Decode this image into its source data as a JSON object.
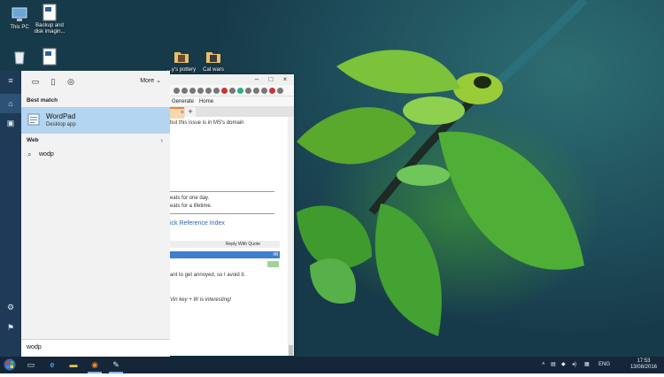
{
  "desktop": {
    "icons": [
      {
        "label": "This PC",
        "icon": "computer-icon"
      },
      {
        "label": "Backup and disk imagin...",
        "icon": "document-icon"
      },
      {
        "label": "",
        "icon": "recycle-bin-icon"
      },
      {
        "label": "",
        "icon": "document-icon"
      },
      {
        "label": "...y's pottery",
        "icon": "folder-icon"
      },
      {
        "label": "Cat wars",
        "icon": "folder-icon"
      }
    ]
  },
  "browser": {
    "bookmarks": {
      "item1": "Generate",
      "item2": "Home"
    },
    "tab_close": "×",
    "new_tab": "+",
    "lines": {
      "l1": "but this issue is in MS's domain",
      "l2": "eats for one day.",
      "l3": "eats for a lifetime.",
      "l4": "ick Reference Index",
      "reply": "Reply With Quote",
      "post_no": "#8",
      "l5": "ant to get annoyed, so I avoid it.",
      "l6": "Vin key + W is interesting!"
    }
  },
  "start_menu": {
    "filters": {
      "more_label": "More"
    },
    "best_match_label": "Best match",
    "best_match": {
      "name": "WordPad",
      "subtitle": "Desktop app"
    },
    "web_label": "Web",
    "web_suggestion": "wodp",
    "search_value": "wodp"
  },
  "taskbar": {
    "language": "ENG",
    "time": "17:53",
    "date": "13/08/2016"
  },
  "colors": {
    "selection": "#b4d5ef",
    "rail": "#1f3a56",
    "taskbar": "#152638",
    "post_header": "#3f7fcf"
  }
}
